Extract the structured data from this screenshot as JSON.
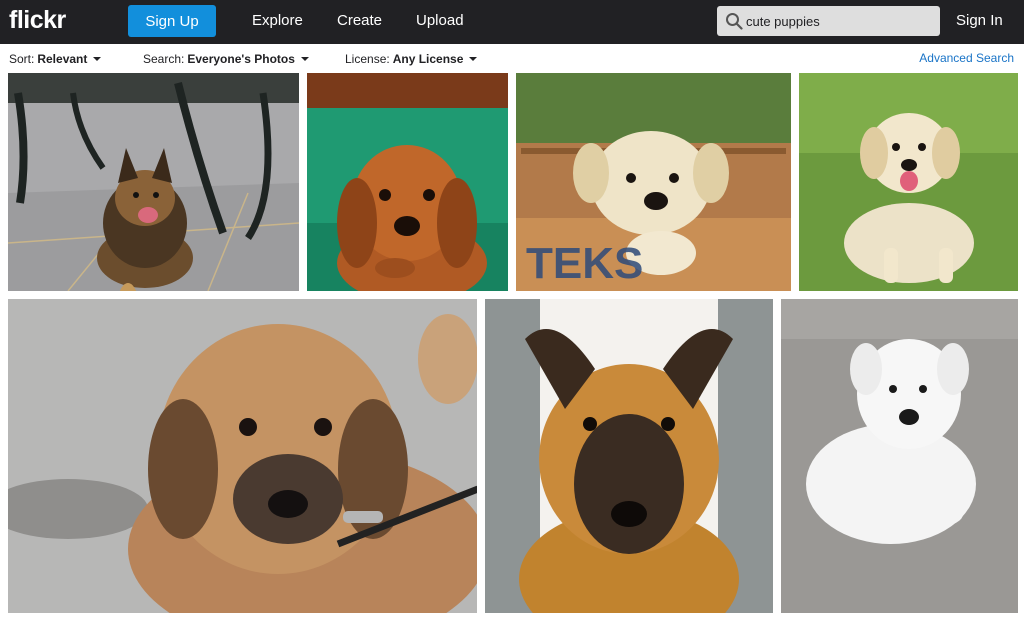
{
  "header": {
    "logo": "flickr",
    "signup": "Sign Up",
    "nav": [
      "Explore",
      "Create",
      "Upload"
    ],
    "search_value": "cute puppies",
    "signin": "Sign In"
  },
  "filters": {
    "sort_label": "Sort:",
    "sort_value": "Relevant",
    "search_label": "Search:",
    "search_value": "Everyone's Photos",
    "license_label": "License:",
    "license_value": "Any License",
    "advanced": "Advanced Search"
  },
  "colors": {
    "accent": "#128fdc",
    "topbar": "#212124",
    "link": "#1a74c7"
  },
  "photos": [
    {
      "name": "german-shepherd-puppy-under-table"
    },
    {
      "name": "dachshund-puppy-on-green-blanket"
    },
    {
      "name": "lab-puppy-in-wooden-crate"
    },
    {
      "name": "golden-puppy-on-grass"
    },
    {
      "name": "fluffy-brown-puppy-on-leash"
    },
    {
      "name": "malinois-puppy-between-legs"
    },
    {
      "name": "white-lab-puppy-on-pavement"
    }
  ]
}
